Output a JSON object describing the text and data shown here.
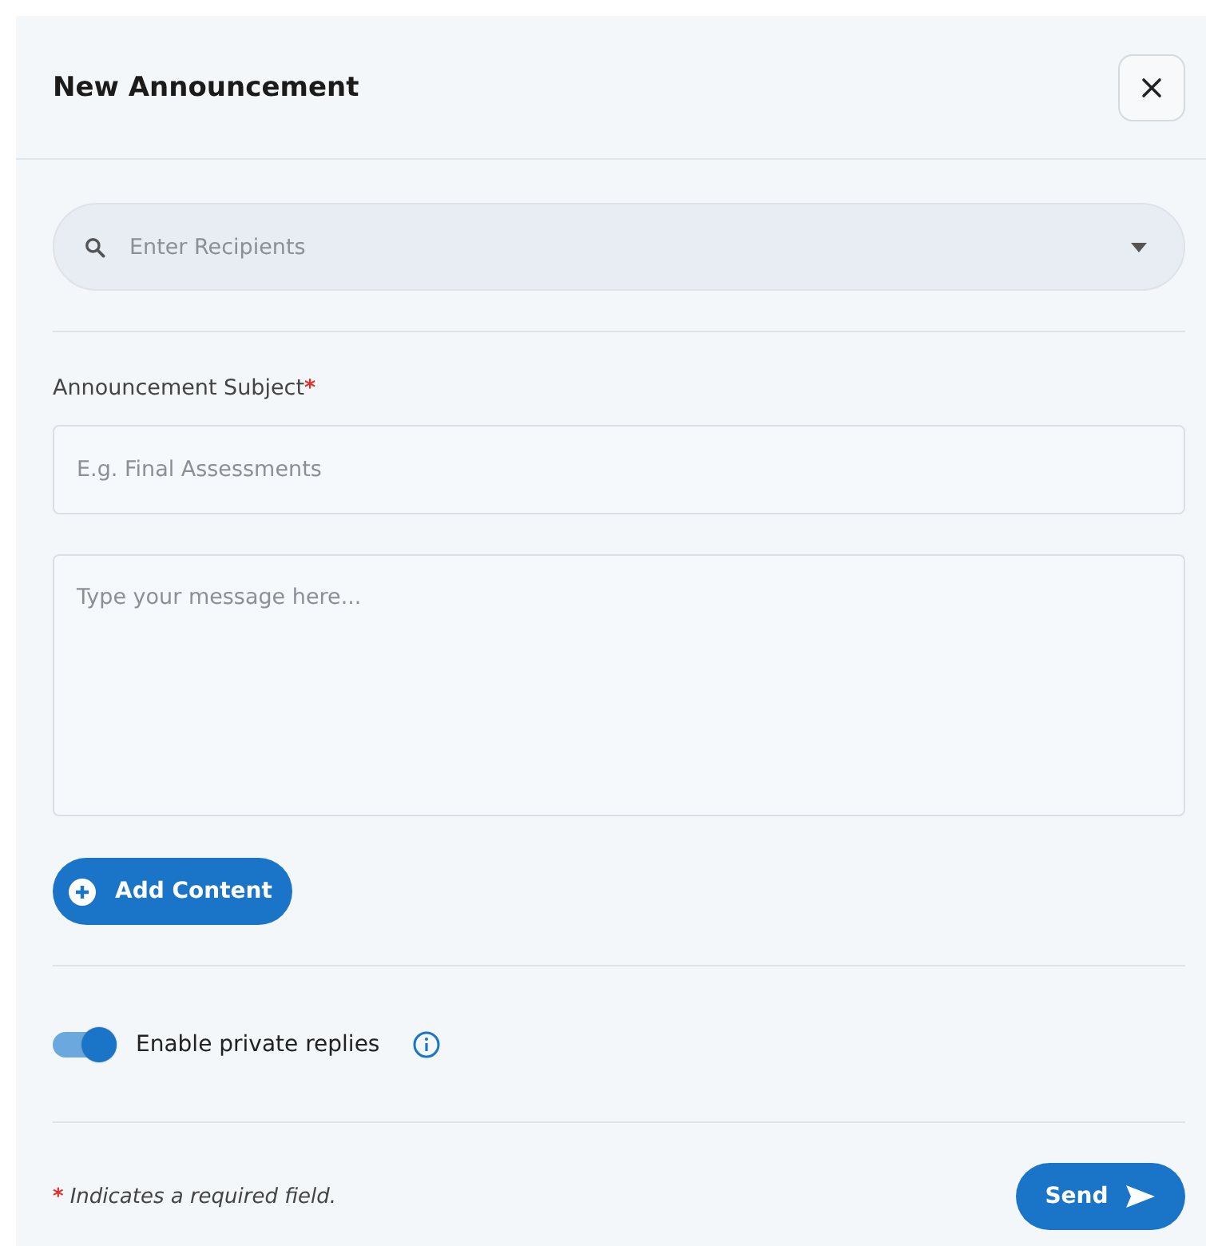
{
  "dialog": {
    "title": "New Announcement"
  },
  "recipients": {
    "placeholder": "Enter Recipients"
  },
  "subject": {
    "label": "Announcement Subject",
    "required_mark": "*",
    "placeholder": "E.g. Final Assessments"
  },
  "message": {
    "placeholder": "Type your message here..."
  },
  "add_content_button": {
    "label": "Add Content"
  },
  "private_replies": {
    "label": "Enable private replies",
    "on": true
  },
  "footer": {
    "required_mark": "*",
    "note": "Indicates a required field.",
    "send_button": "Send"
  }
}
